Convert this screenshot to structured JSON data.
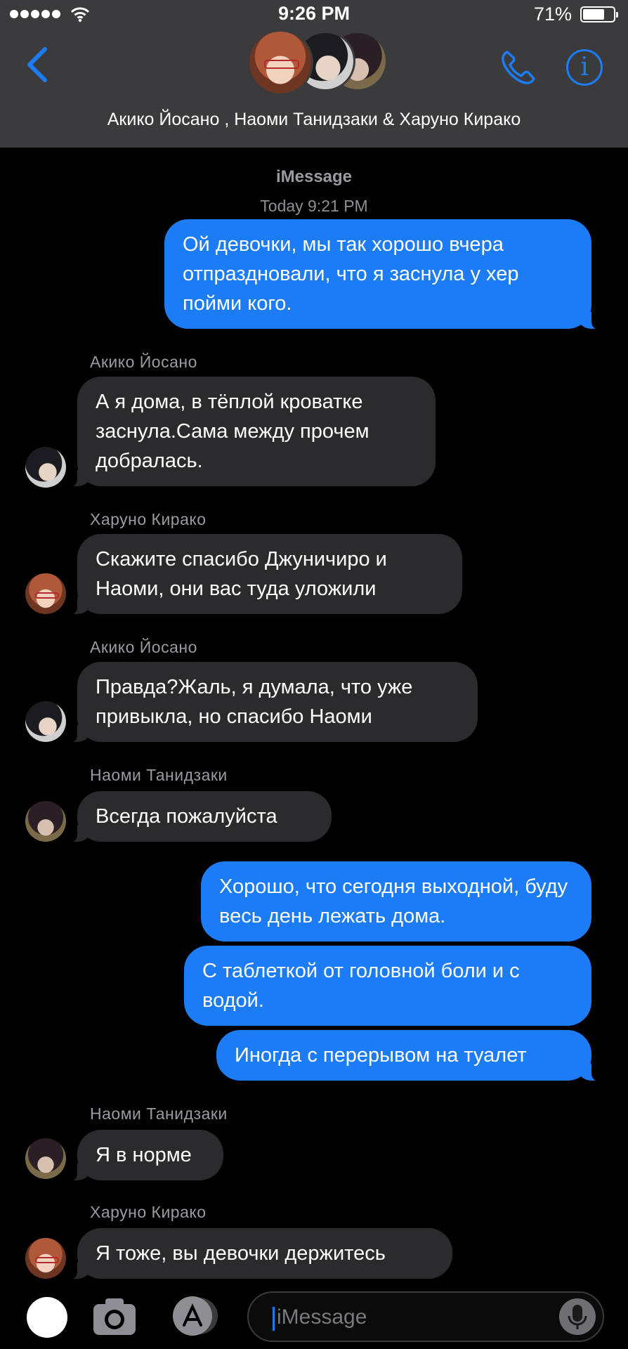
{
  "status_bar": {
    "time": "9:26 PM",
    "battery": "71%",
    "battery_level": 0.71
  },
  "header": {
    "title": "Акико Йосано , Наоми Танидзаки & Харуно Кирако"
  },
  "thread": {
    "service": "iMessage",
    "timestamp": "Today 9:21 PM"
  },
  "messages": [
    {
      "dir": "out",
      "text": "Ой девочки, мы так хорошо вчера отпраздновали, что я заснула у хер пойми кого."
    },
    {
      "dir": "in",
      "sender": "Акико Йосано",
      "text": "А я дома, в тёплой кроватке заснула.Сама между прочем добралась."
    },
    {
      "dir": "in",
      "sender": "Харуно Кирако",
      "text": "Скажите спасибо Джуничиро и Наоми, они вас туда уложили"
    },
    {
      "dir": "in",
      "sender": "Акико Йосано",
      "text": "Правда?Жаль, я думала, что уже привыкла, но спасибо Наоми"
    },
    {
      "dir": "in",
      "sender": "Наоми Танидзаки",
      "text": "Всегда пожалуйста"
    },
    {
      "dir": "out",
      "text": "Хорошо, что сегодня выходной, буду весь день лежать дома."
    },
    {
      "dir": "out",
      "text": "С таблеткой от головной боли и с водой."
    },
    {
      "dir": "out",
      "text": "Иногда с перерывом на туалет"
    },
    {
      "dir": "in",
      "sender": "Наоми Танидзаки",
      "text": "Я в норме"
    },
    {
      "dir": "in",
      "sender": "Харуно Кирако",
      "text": "Я тоже, вы девочки держитесь"
    }
  ],
  "composer": {
    "placeholder": "iMessage"
  },
  "colors": {
    "accent": "#1c7cf6",
    "header_bg": "#3b3b3d",
    "incoming_bubble": "#2b2b2e",
    "background": "#000000"
  },
  "icons": {
    "back": "chevron-left-icon",
    "call": "phone-icon",
    "info": "info-icon",
    "camera": "camera-icon",
    "apps": "app-store-icon",
    "mic": "microphone-icon"
  }
}
